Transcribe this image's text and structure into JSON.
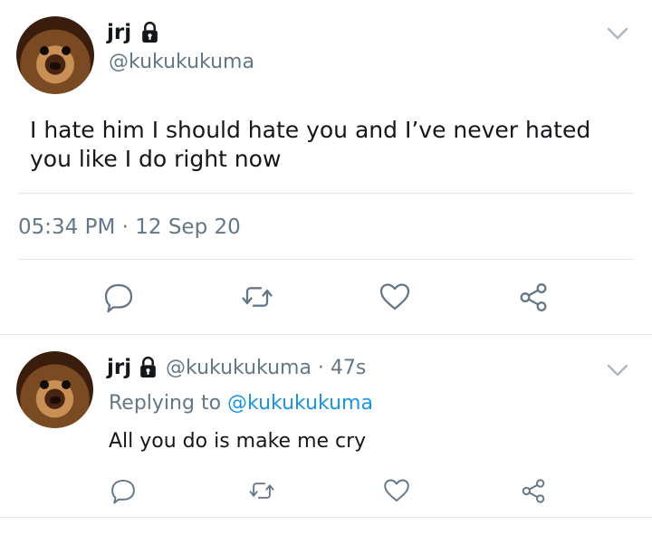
{
  "main_tweet": {
    "display_name": "jrj",
    "handle": "@kukukukuma",
    "text_line_1": "I hate him I should hate you and I’ve never hated",
    "text_line_2": "you like I do right now",
    "timestamp": "05:34 PM · 12 Sep 20",
    "icons": {
      "lock": "lock-icon",
      "dropdown": "chevron-down-icon",
      "reply": "reply-icon",
      "retweet": "retweet-icon",
      "like": "heart-icon",
      "share": "share-icon"
    }
  },
  "reply_tweet": {
    "display_name": "jrj",
    "handle_time": "@kukukukuma · 47s",
    "replying_prefix": "Replying to",
    "replying_handle": "@kukukukuma",
    "text": "All you do is make me cry",
    "icons": {
      "lock": "lock-icon",
      "dropdown": "chevron-down-icon",
      "reply": "reply-icon",
      "retweet": "retweet-icon",
      "like": "heart-icon",
      "share": "share-icon"
    }
  },
  "colors": {
    "text": "#14171a",
    "secondary": "#657786",
    "link": "#1b95e0",
    "divider": "#e1e8ed",
    "icon": "#657786"
  }
}
